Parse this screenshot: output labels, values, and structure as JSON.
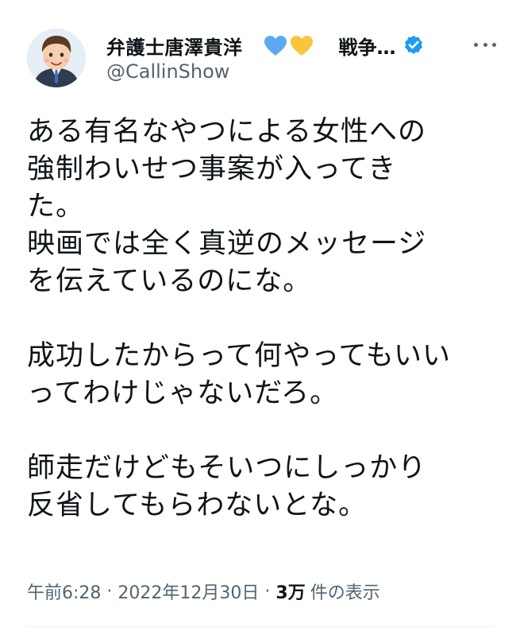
{
  "author": {
    "display_name": "弁護士唐澤貴洋",
    "extra_name": "戦争…",
    "handle": "@CallinShow",
    "heart_colors": [
      "#5ca9ef",
      "#f8c63c"
    ],
    "verified_color": "#1d9bf0"
  },
  "tweet": {
    "text": "ある有名なやつによる女性への\n強制わいせつ事案が入ってき\nた。\n映画では全く真逆のメッセージ\nを伝えているのにな。\n\n成功したからって何やってもいい\nってわけじゃないだろ。\n\n師走だけどもそいつにしっかり\n反省してもらわないとな。"
  },
  "meta": {
    "time": "午前6:28",
    "separator": "·",
    "date": "2022年12月30日",
    "views_count": "3万",
    "views_label": "件の表示"
  },
  "icons": {
    "more": "more-dots-icon",
    "verified": "verified-badge-icon",
    "hearts": [
      "blue-heart-icon",
      "yellow-heart-icon"
    ]
  }
}
